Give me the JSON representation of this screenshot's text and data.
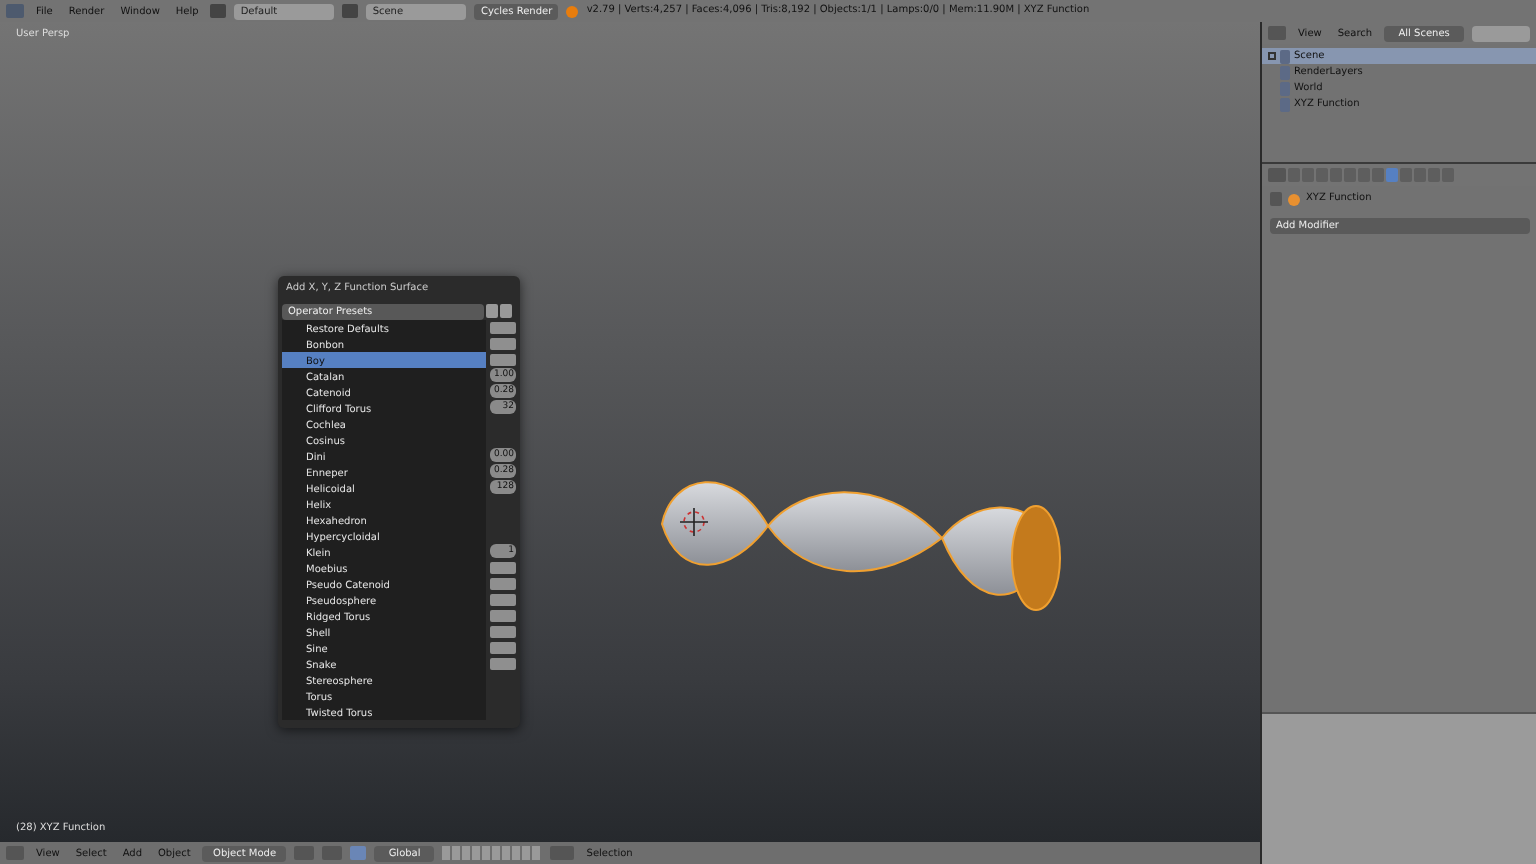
{
  "top_bar": {
    "menus": [
      "File",
      "Render",
      "Window",
      "Help"
    ],
    "layout": "Default",
    "scene": "Scene",
    "engine": "Cycles Render",
    "stats": "v2.79 | Verts:4,257 | Faces:4,096 | Tris:8,192 | Objects:1/1 | Lamps:0/0 | Mem:11.90M | XYZ Function"
  },
  "viewport": {
    "view_label": "User Persp",
    "object_label": "(28) XYZ Function"
  },
  "dialog": {
    "title": "Add X, Y, Z Function Surface",
    "presets_label": "Operator Presets",
    "menu_items": [
      {
        "label": "Restore Defaults",
        "selected": false,
        "kind": "blank"
      },
      {
        "label": "Bonbon",
        "selected": false,
        "kind": "blank"
      },
      {
        "label": "Boy",
        "selected": true,
        "kind": "blank"
      },
      {
        "label": "Catalan",
        "selected": false,
        "kind": "number",
        "value": "1.00"
      },
      {
        "label": "Catenoid",
        "selected": false,
        "kind": "number",
        "value": "0.28"
      },
      {
        "label": "Clifford Torus",
        "selected": false,
        "kind": "number",
        "value": "32"
      },
      {
        "label": "Cochlea",
        "selected": false,
        "kind": "plain"
      },
      {
        "label": "Cosinus",
        "selected": false,
        "kind": "plain"
      },
      {
        "label": "Dini",
        "selected": false,
        "kind": "number",
        "value": "0.00"
      },
      {
        "label": "Enneper",
        "selected": false,
        "kind": "number",
        "value": "0.28"
      },
      {
        "label": "Helicoidal",
        "selected": false,
        "kind": "number",
        "value": "128"
      },
      {
        "label": "Helix",
        "selected": false,
        "kind": "plain"
      },
      {
        "label": "Hexahedron",
        "selected": false,
        "kind": "plain"
      },
      {
        "label": "Hypercycloidal",
        "selected": false,
        "kind": "plain"
      },
      {
        "label": "Klein",
        "selected": false,
        "kind": "number",
        "value": "1"
      },
      {
        "label": "Moebius",
        "selected": false,
        "kind": "blank"
      },
      {
        "label": "Pseudo Catenoid",
        "selected": false,
        "kind": "blank"
      },
      {
        "label": "Pseudosphere",
        "selected": false,
        "kind": "blank"
      },
      {
        "label": "Ridged Torus",
        "selected": false,
        "kind": "blank"
      },
      {
        "label": "Shell",
        "selected": false,
        "kind": "blank"
      },
      {
        "label": "Sine",
        "selected": false,
        "kind": "blank"
      },
      {
        "label": "Snake",
        "selected": false,
        "kind": "blank"
      },
      {
        "label": "Stereosphere",
        "selected": false,
        "kind": "plain"
      },
      {
        "label": "Torus",
        "selected": false,
        "kind": "plain"
      },
      {
        "label": "Twisted Torus",
        "selected": false,
        "kind": "plain"
      }
    ]
  },
  "viewport_header": {
    "menus": [
      "View",
      "Select",
      "Add",
      "Object"
    ],
    "mode": "Object Mode",
    "orientation": "Global",
    "selection_label": "Selection"
  },
  "outliner": {
    "menus": [
      "View",
      "Search"
    ],
    "filter": "All Scenes",
    "tree": [
      {
        "label": "Scene",
        "expanded": true,
        "children": [
          {
            "label": "RenderLayers"
          },
          {
            "label": "World"
          },
          {
            "label": "XYZ Function"
          }
        ]
      }
    ]
  },
  "properties": {
    "breadcrumb": "XYZ Function",
    "add_modifier": "Add Modifier"
  }
}
